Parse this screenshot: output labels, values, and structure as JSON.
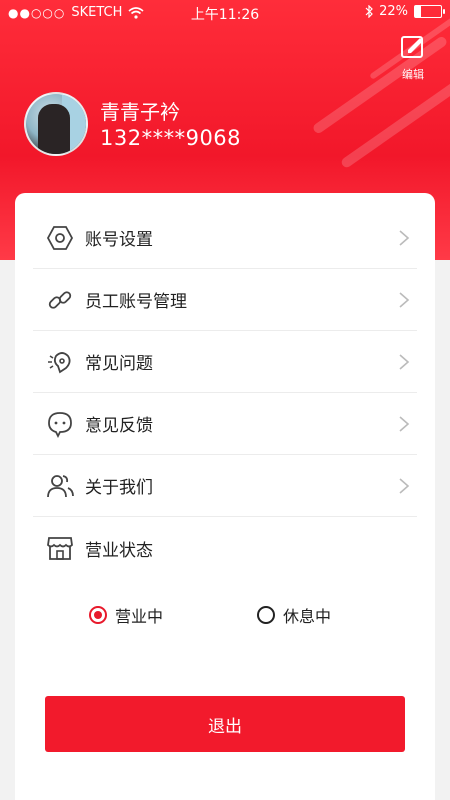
{
  "status_bar": {
    "carrier": "SKETCH",
    "time": "上午11:26",
    "battery": "22%",
    "battery_level": 0.22
  },
  "header": {
    "edit_label": "编辑",
    "user_name": "青青子衿",
    "phone": "132****9068"
  },
  "menu": {
    "items": [
      {
        "label": "账号设置",
        "icon": "hexagon-settings-icon"
      },
      {
        "label": "员工账号管理",
        "icon": "link-icon"
      },
      {
        "label": "常见问题",
        "icon": "question-bulb-icon"
      },
      {
        "label": "意见反馈",
        "icon": "chat-bubble-icon"
      },
      {
        "label": "关于我们",
        "icon": "users-icon"
      },
      {
        "label": "营业状态",
        "icon": "store-icon"
      }
    ]
  },
  "business_status": {
    "options": [
      "营业中",
      "休息中"
    ],
    "selected": "营业中"
  },
  "logout_label": "退出",
  "colors": {
    "accent": "#f21a2c",
    "header_red": "#f2172a"
  }
}
